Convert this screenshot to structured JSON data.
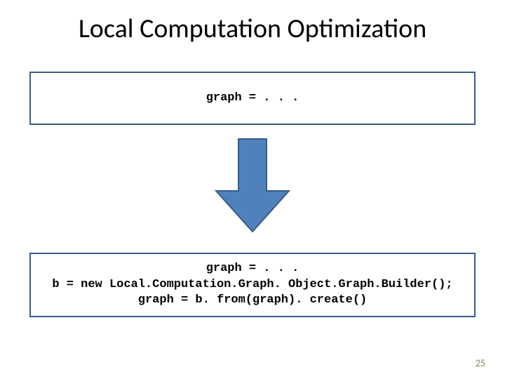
{
  "title": "Local Computation Optimization",
  "code_box_1": {
    "line1": "graph = . . ."
  },
  "code_box_2": {
    "line1": "graph = . . .",
    "line2": "b = new Local.Computation.Graph. Object.Graph.Builder();",
    "line3": "graph = b. from(graph). create()"
  },
  "arrow": {
    "fill": "#4f81bd",
    "stroke": "#385d8a"
  },
  "page_number": "25"
}
